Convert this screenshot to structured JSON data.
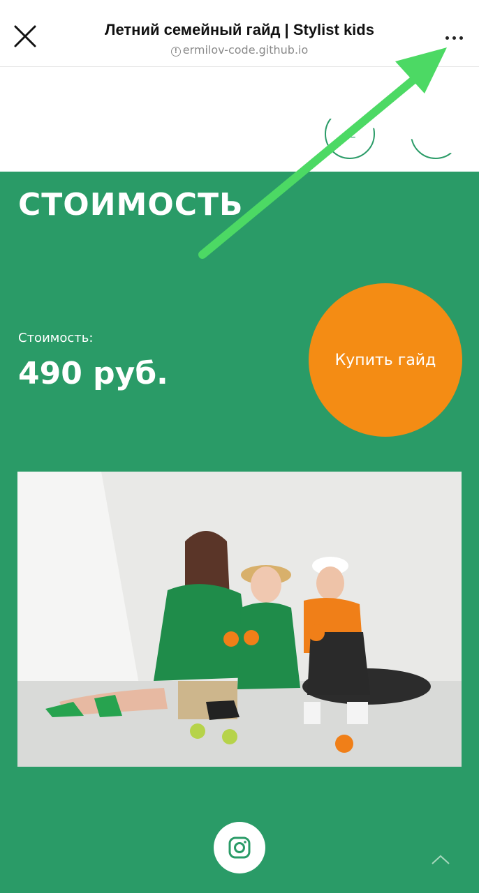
{
  "header": {
    "title": "Летний семейный гайд | Stylist kids",
    "url": "ermilov-code.github.io",
    "close_icon": "close-icon",
    "more_icon": "more-dots-icon",
    "info_icon": "info-icon"
  },
  "section": {
    "title": "СТОИМОСТЬ",
    "price_label": "Стоимость:",
    "price_value": "490 руб.",
    "buy_button": "Купить гайд"
  },
  "footer": {
    "social_icon": "instagram-icon",
    "scroll_top_icon": "chevron-up-icon"
  },
  "colors": {
    "brand_green": "#2a9b67",
    "accent_orange": "#f48c14",
    "annotation_arrow": "#4cd964"
  }
}
